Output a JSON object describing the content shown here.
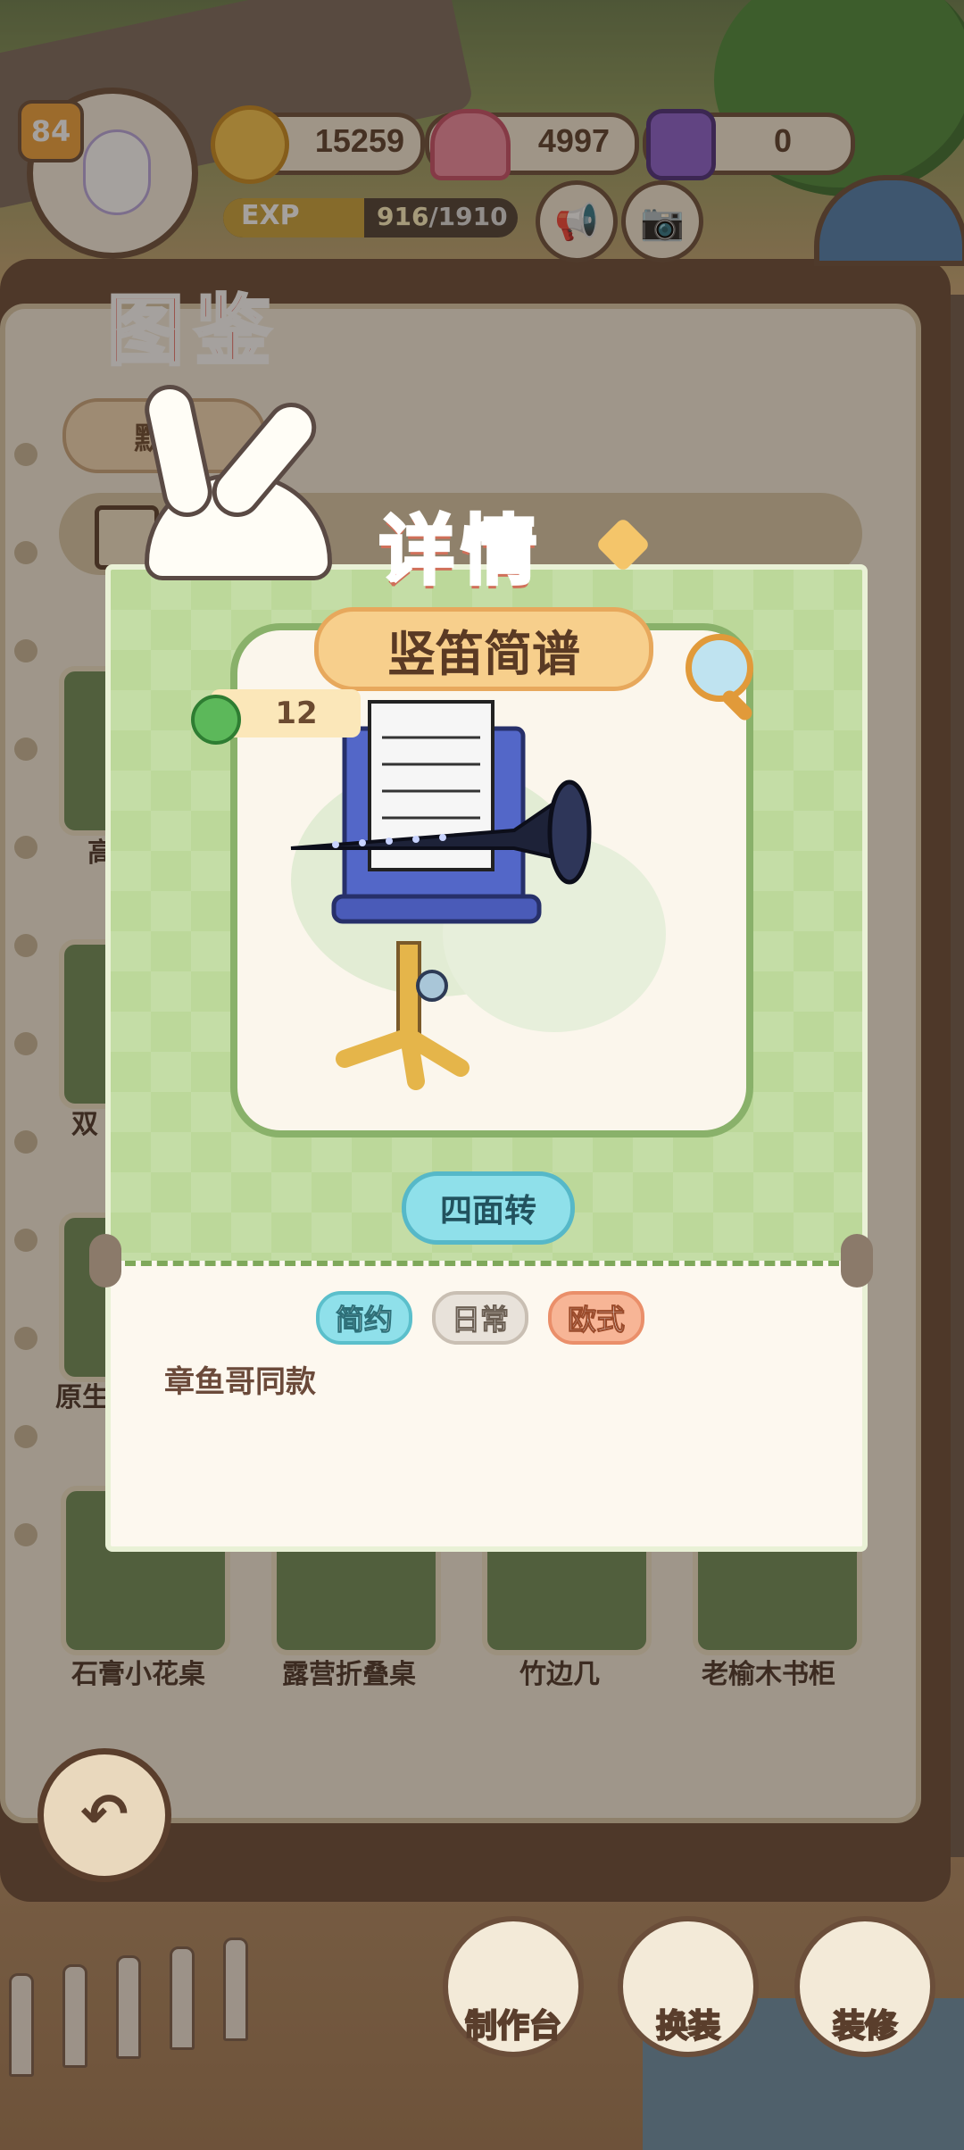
{
  "hud": {
    "level": "84",
    "coins": "15259",
    "hearts": "4997",
    "gems": "0",
    "exp_label": "EXP",
    "exp_current": "916",
    "exp_total": "/1910",
    "exp_progress": 0.48
  },
  "book": {
    "title": "图鉴",
    "filter_label": "默认",
    "bg_item_labels": [
      "高",
      "双",
      "原生"
    ],
    "bottom_items": [
      "石膏小花桌",
      "露营折叠桌",
      "竹边几",
      "老榆木书柜"
    ]
  },
  "detail": {
    "heading": "详情",
    "item_name": "竖笛简谱",
    "score": "12",
    "rotate_label": "四面转",
    "tags": [
      {
        "label": "简约",
        "color": "#8fe0ea"
      },
      {
        "label": "日常",
        "color": "#e8e2da"
      },
      {
        "label": "欧式",
        "color": "#f7b596"
      }
    ],
    "description": "章鱼哥同款"
  },
  "actions": {
    "workbench": "制作台",
    "outfit": "换装",
    "decorate": "装修"
  },
  "icons": {
    "back": "back-arrow-icon",
    "megaphone": "megaphone-icon",
    "camera": "camera-icon",
    "magnifier": "magnifier-icon",
    "clover": "clover-icon"
  }
}
